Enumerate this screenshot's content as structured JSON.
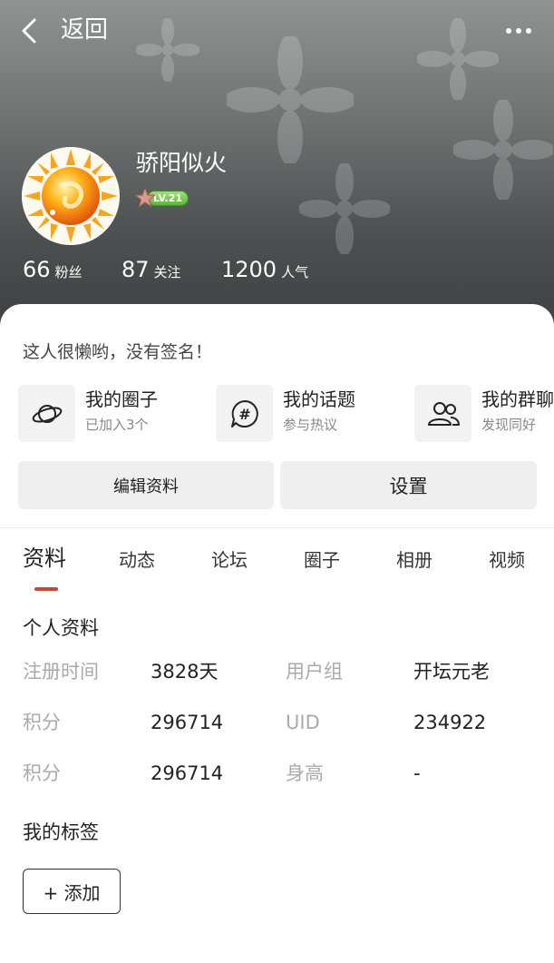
{
  "topbar": {
    "back_label": "返回"
  },
  "profile": {
    "username": "骄阳似火",
    "level": "LV.21",
    "stats": [
      {
        "value": "66",
        "label": "粉丝"
      },
      {
        "value": "87",
        "label": "关注"
      },
      {
        "value": "1200",
        "label": "人气"
      }
    ],
    "signature": "这人很懒哟，没有签名！"
  },
  "quick_links": [
    {
      "title": "我的圈子",
      "subtitle": "已加入3个",
      "icon": "planet-icon"
    },
    {
      "title": "我的话题",
      "subtitle": "参与热议",
      "icon": "hashtag-chat-icon"
    },
    {
      "title": "我的群聊",
      "subtitle": "发现同好",
      "icon": "group-users-icon"
    }
  ],
  "actions": {
    "edit_label": "编辑资料",
    "settings_label": "设置"
  },
  "tabs": [
    "资料",
    "动态",
    "论坛",
    "圈子",
    "相册",
    "视频"
  ],
  "active_tab": "资料",
  "personal_info": {
    "title": "个人资料",
    "rows": [
      {
        "label1": "注册时间",
        "value1": "3828天",
        "label2": "用户组",
        "value2": "开坛元老"
      },
      {
        "label1": "积分",
        "value1": "296714",
        "label2": "UID",
        "value2": "234922"
      },
      {
        "label1": "积分",
        "value1": "296714",
        "label2": "身高",
        "value2": "-"
      }
    ]
  },
  "tags": {
    "title": "我的标签",
    "add_label": "+ 添加"
  },
  "colors": {
    "accent": "#c8473d",
    "header_dark": "#3c4040",
    "level_green": "#5fb43d"
  }
}
